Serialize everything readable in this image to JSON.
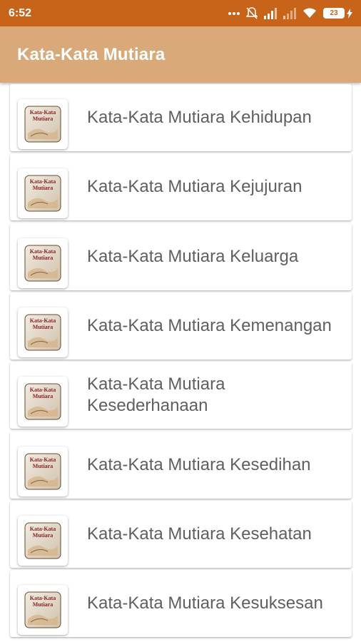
{
  "status_bar": {
    "time": "6:52",
    "battery_level": "23",
    "icons": [
      "more-dots-icon",
      "mute-icon",
      "signal-icon",
      "signal-weak-icon",
      "wifi-icon",
      "battery-icon",
      "charging-icon"
    ]
  },
  "app_bar": {
    "title": "Kata-Kata Mutiara",
    "color": "#d9a97a"
  },
  "list": {
    "items": [
      {
        "label": "Kata-Kata Mutiara Kehidupan",
        "icon": "book-thumbnail-icon"
      },
      {
        "label": "Kata-Kata Mutiara Kejujuran",
        "icon": "book-thumbnail-icon"
      },
      {
        "label": "Kata-Kata Mutiara Keluarga",
        "icon": "book-thumbnail-icon"
      },
      {
        "label": "Kata-Kata Mutiara Kemenangan",
        "icon": "book-thumbnail-icon"
      },
      {
        "label": "Kata-Kata Mutiara Kesederhanaan",
        "icon": "book-thumbnail-icon"
      },
      {
        "label": "Kata-Kata Mutiara Kesedihan",
        "icon": "book-thumbnail-icon"
      },
      {
        "label": "Kata-Kata Mutiara Kesehatan",
        "icon": "book-thumbnail-icon"
      },
      {
        "label": "Kata-Kata Mutiara Kesuksesan",
        "icon": "book-thumbnail-icon"
      }
    ],
    "thumbnail_text": "Kata-Kata Mutiara"
  }
}
